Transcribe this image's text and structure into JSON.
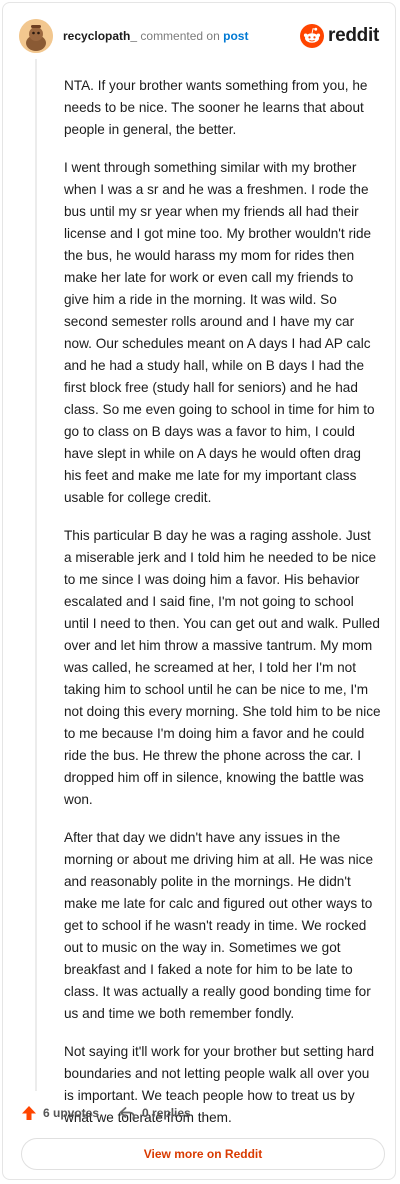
{
  "header": {
    "username": "recyclopath_",
    "verb": "commented on",
    "target": "post",
    "brand": "reddit",
    "brand_color": "#ff4500"
  },
  "comment": {
    "paragraphs": [
      "NTA. If your brother wants something from you, he needs to be nice. The sooner he learns that about people in general, the better.",
      "I went through something similar with my brother when I was a sr and he was a freshmen. I rode the bus until my sr year when my friends all had their license and I got mine too. My brother wouldn't ride the bus, he would harass my mom for rides then make her late for work or even call my friends to give him a ride in the morning. It was wild. So second semester rolls around and I have my car now. Our schedules meant on A days I had AP calc and he had a study hall, while on B days I had the first block free (study hall for seniors) and he had class. So me even going to school in time for him to go to class on B days was a favor to him, I could have slept in while on A days he would often drag his feet and make me late for my important class usable for college credit.",
      "This particular B day he was a raging asshole. Just a miserable jerk and I told him he needed to be nice to me since I was doing him a favor. His behavior escalated and I said fine, I'm not going to school until I need to then. You can get out and walk. Pulled over and let him throw a massive tantrum. My mom was called, he screamed at her, I told her I'm not taking him to school until he can be nice to me, I'm not doing this every morning. She told him to be nice to me because I'm doing him a favor and he could ride the bus. He threw the phone across the car. I dropped him off in silence, knowing the battle was won.",
      "After that day we didn't have any issues in the morning or about me driving him at all. He was nice and reasonably polite in the mornings. He didn't make me late for calc and figured out other ways to get to school if he wasn't ready in time. We rocked out to music on the way in. Sometimes we got breakfast and I faked a note for him to be late to class. It was actually a really good bonding time for us and time we both remember fondly.",
      "Not saying it'll work for your brother but setting hard boundaries and not letting people walk all over you is important. We teach people how to treat us by what we tolerate from them."
    ]
  },
  "actions": {
    "upvotes": "6 upvotes",
    "replies": "0 replies",
    "upvote_icon": "upvote-arrow-icon",
    "reply_icon": "reply-arrow-icon",
    "upvote_color": "#ff4500"
  },
  "footer": {
    "view_button": "View more on Reddit",
    "view_color": "#d93a00"
  }
}
